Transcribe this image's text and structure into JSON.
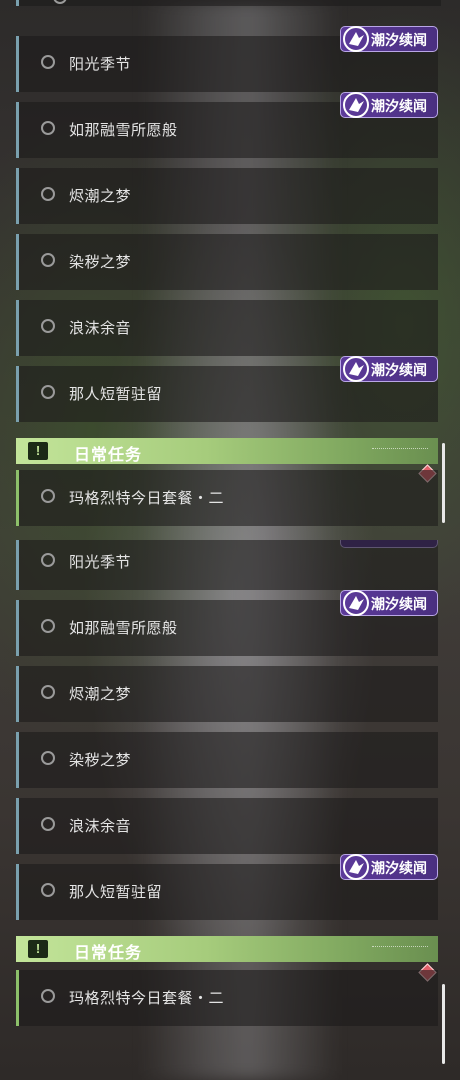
{
  "tag_text": "潮汐续闻",
  "section_title": "日常任务",
  "section_icon": "!",
  "quests": [
    {
      "label": "阳光季节"
    },
    {
      "label": "如那融雪所愿般"
    },
    {
      "label": "烬潮之梦"
    },
    {
      "label": "染秽之梦"
    },
    {
      "label": "浪沫余音"
    },
    {
      "label": "那人短暂驻留"
    }
  ],
  "daily_quest": {
    "label": "玛格烈特今日套餐・二"
  },
  "colors": {
    "tag_bg": "#5c3a9a",
    "header_green": "#b5dc8a",
    "row_accent": "#7aa0ae",
    "daily_accent": "#8dc06a",
    "diamond": "#e0606a"
  }
}
